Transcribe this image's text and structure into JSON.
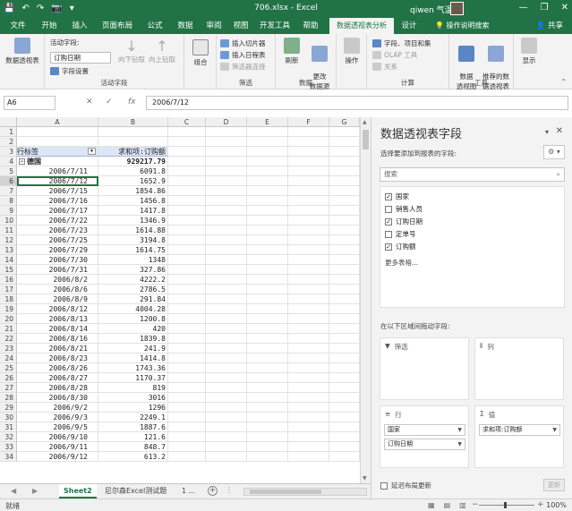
{
  "window": {
    "title": "706.xlsx - Excel",
    "user": "qiwen 气温",
    "ctrl_min": "—",
    "ctrl_max": "❐",
    "ctrl_close": "✕"
  },
  "tabs": {
    "items": [
      "文件",
      "开始",
      "插入",
      "页面布局",
      "公式",
      "数据",
      "审阅",
      "视图",
      "开发工具",
      "帮助"
    ],
    "context": "数据透视表分析",
    "design": "设计",
    "tell_me": "操作说明搜索",
    "share": "共享"
  },
  "ribbon": {
    "pivot_group_label": "数据透视表",
    "active_field_label": "活动字段:",
    "active_field_value": "订购日期",
    "field_settings": "字段设置",
    "drill_down": "向下钻取",
    "drill_up": "向上钻取",
    "active_field_group": "活动字段",
    "group_label": "组合",
    "insert_slicer": "插入切片器",
    "insert_timeline": "插入日程表",
    "filter_connections": "筛选器连接",
    "filter_group": "筛选",
    "refresh": "刷新",
    "change_source": "更改\n数据源",
    "data_group": "数据",
    "actions": "操作",
    "fields_items": "字段、项目和集",
    "olap_tools": "OLAP 工具",
    "relationships": "关系",
    "calc_group": "计算",
    "pivot_chart": "数据\n透视图",
    "recommended": "推荐的数\n据透视表",
    "tools_group": "工具",
    "show": "显示"
  },
  "formula_bar": {
    "name_box": "A6",
    "cancel": "✕",
    "enter": "✓",
    "fx": "fx",
    "content": "2006/7/12"
  },
  "grid": {
    "columns": [
      "A",
      "B",
      "C",
      "D",
      "E",
      "F",
      "G"
    ],
    "header_row": {
      "a": "行标签",
      "b": "求和项:订购额"
    },
    "grand_row": {
      "a": "德国",
      "b": "929217.79"
    },
    "rows": [
      {
        "n": "5",
        "a": "2006/7/11",
        "b": "6091.8"
      },
      {
        "n": "6",
        "a": "2006/7/12",
        "b": "1652.9"
      },
      {
        "n": "7",
        "a": "2006/7/15",
        "b": "1854.86"
      },
      {
        "n": "8",
        "a": "2006/7/16",
        "b": "1456.8"
      },
      {
        "n": "9",
        "a": "2006/7/17",
        "b": "1417.8"
      },
      {
        "n": "10",
        "a": "2006/7/22",
        "b": "1346.9"
      },
      {
        "n": "11",
        "a": "2006/7/23",
        "b": "1614.88"
      },
      {
        "n": "12",
        "a": "2006/7/25",
        "b": "3194.8"
      },
      {
        "n": "13",
        "a": "2006/7/29",
        "b": "1614.75"
      },
      {
        "n": "14",
        "a": "2006/7/30",
        "b": "1348"
      },
      {
        "n": "15",
        "a": "2006/7/31",
        "b": "327.86"
      },
      {
        "n": "16",
        "a": "2006/8/2",
        "b": "4222.2"
      },
      {
        "n": "17",
        "a": "2006/8/6",
        "b": "2786.5"
      },
      {
        "n": "18",
        "a": "2006/8/9",
        "b": "291.84"
      },
      {
        "n": "19",
        "a": "2006/8/12",
        "b": "4004.28"
      },
      {
        "n": "20",
        "a": "2006/8/13",
        "b": "1200.8"
      },
      {
        "n": "21",
        "a": "2006/8/14",
        "b": "420"
      },
      {
        "n": "22",
        "a": "2006/8/16",
        "b": "1839.8"
      },
      {
        "n": "23",
        "a": "2006/8/21",
        "b": "241.9"
      },
      {
        "n": "24",
        "a": "2006/8/23",
        "b": "1414.8"
      },
      {
        "n": "25",
        "a": "2006/8/26",
        "b": "1743.36"
      },
      {
        "n": "26",
        "a": "2006/8/27",
        "b": "1170.37"
      },
      {
        "n": "27",
        "a": "2006/8/28",
        "b": "819"
      },
      {
        "n": "28",
        "a": "2006/8/30",
        "b": "3016"
      },
      {
        "n": "29",
        "a": "2006/9/2",
        "b": "1296"
      },
      {
        "n": "30",
        "a": "2006/9/3",
        "b": "2249.1"
      },
      {
        "n": "31",
        "a": "2006/9/5",
        "b": "1887.6"
      },
      {
        "n": "32",
        "a": "2006/9/10",
        "b": "121.6"
      },
      {
        "n": "33",
        "a": "2006/9/11",
        "b": "848.7"
      },
      {
        "n": "34",
        "a": "2006/9/12",
        "b": "613.2"
      }
    ],
    "row_nums_top": [
      "1",
      "2",
      "3",
      "4"
    ]
  },
  "sheets": {
    "tabs": [
      "Sheet2",
      "尼尔森Excel测试题",
      "1 ..."
    ],
    "active": "Sheet2"
  },
  "status": {
    "ready": "就绪",
    "zoom": "100%",
    "minus": "−",
    "plus": "+"
  },
  "pivot_pane": {
    "title": "数据透视表字段",
    "subtitle": "选择要添加到报表的字段:",
    "search_placeholder": "搜索",
    "fields": [
      {
        "label": "国家",
        "checked": true
      },
      {
        "label": "销售人员",
        "checked": false
      },
      {
        "label": "订购日期",
        "checked": true
      },
      {
        "label": "定单号",
        "checked": false
      },
      {
        "label": "订购额",
        "checked": true
      }
    ],
    "more_tables": "更多表格...",
    "drag_hint": "在以下区域间拖动字段:",
    "areas": {
      "filters": "筛选",
      "columns": "列",
      "rows": "行",
      "values": "值",
      "row_fields": [
        "国家",
        "订购日期"
      ],
      "value_fields": [
        "求和项:订购额"
      ]
    },
    "defer_update": "延迟布局更新",
    "update_button": "更新"
  }
}
